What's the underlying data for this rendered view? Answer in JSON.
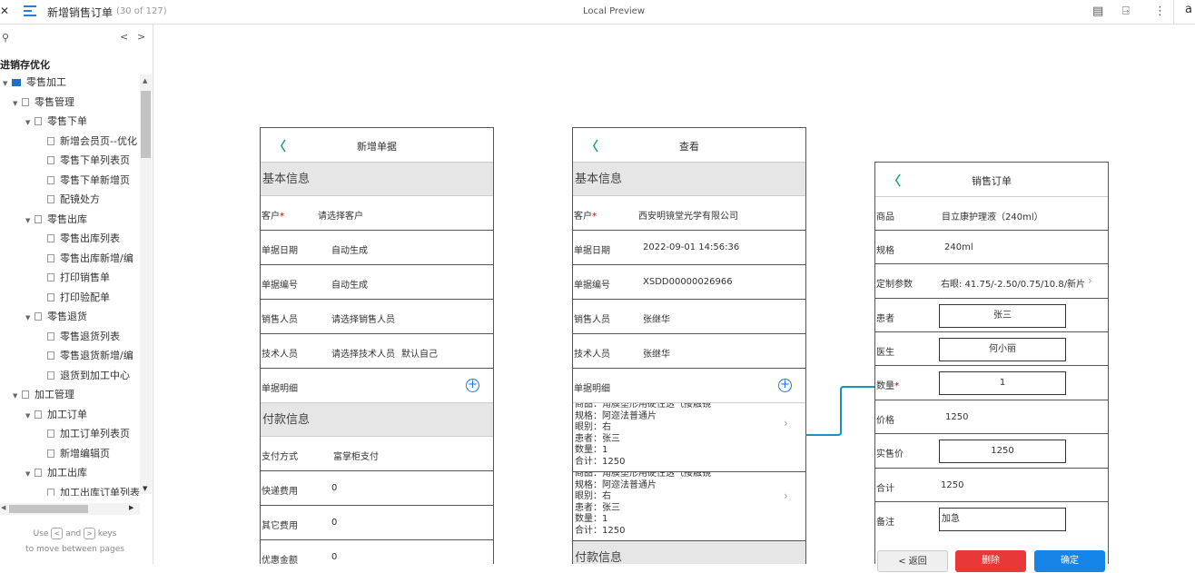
{
  "topbar": {
    "title": "新增销售订单",
    "count": "(30 of 127)",
    "preview": "Local Preview",
    "close_icon": "close-icon",
    "right_letter": "a"
  },
  "sidebar": {
    "heading": "进销存优化",
    "hint_line1_use": "Use",
    "hint_key_prev": "<",
    "hint_and": "and",
    "hint_key_next": ">",
    "hint_keys": "keys",
    "hint_line2": "to move between pages",
    "tree": [
      {
        "label": "零售加工",
        "level": 0,
        "kind": "folder"
      },
      {
        "label": "零售管理",
        "level": 1,
        "kind": "page"
      },
      {
        "label": "零售下单",
        "level": 2,
        "kind": "page"
      },
      {
        "label": "新增会员页--优化",
        "level": 3,
        "kind": "page"
      },
      {
        "label": "零售下单列表页",
        "level": 3,
        "kind": "page"
      },
      {
        "label": "零售下单新增页",
        "level": 3,
        "kind": "page"
      },
      {
        "label": "配镜处方",
        "level": 3,
        "kind": "page"
      },
      {
        "label": "零售出库",
        "level": 2,
        "kind": "page"
      },
      {
        "label": "零售出库列表",
        "level": 3,
        "kind": "page"
      },
      {
        "label": "零售出库新增/编",
        "level": 3,
        "kind": "page"
      },
      {
        "label": "打印销售单",
        "level": 3,
        "kind": "page"
      },
      {
        "label": "打印验配单",
        "level": 3,
        "kind": "page"
      },
      {
        "label": "零售退货",
        "level": 2,
        "kind": "page"
      },
      {
        "label": "零售退货列表",
        "level": 3,
        "kind": "page"
      },
      {
        "label": "零售退货新增/编",
        "level": 3,
        "kind": "page"
      },
      {
        "label": "退货到加工中心",
        "level": 3,
        "kind": "page"
      },
      {
        "label": "加工管理",
        "level": 1,
        "kind": "page"
      },
      {
        "label": "加工订单",
        "level": 2,
        "kind": "page"
      },
      {
        "label": "加工订单列表页",
        "level": 3,
        "kind": "page"
      },
      {
        "label": "新增编辑页",
        "level": 3,
        "kind": "page"
      },
      {
        "label": "加工出库",
        "level": 2,
        "kind": "page"
      },
      {
        "label": "加工出库订单列表",
        "level": 3,
        "kind": "page"
      }
    ]
  },
  "frame1": {
    "title": "新增单据",
    "basic_section": "基本信息",
    "customer_label": "客户",
    "customer_value": "请选择客户",
    "date_label": "单据日期",
    "date_value": "自动生成",
    "number_label": "单据编号",
    "number_value": "自动生成",
    "sales_label": "销售人员",
    "sales_value": "请选择销售人员",
    "tech_label": "技术人员",
    "tech_value": "请选择技术人员",
    "tech_default": "默认自己",
    "detail_label": "单据明细",
    "payment_section": "付款信息",
    "pay_method_label": "支付方式",
    "pay_method_value": "富掌柜支付",
    "express_label": "快递费用",
    "express_value": "0",
    "other_label": "其它费用",
    "other_value": "0",
    "discount_label": "优惠金额",
    "discount_value": "0"
  },
  "frame2": {
    "title": "查看",
    "basic_section": "基本信息",
    "customer_label": "客户",
    "customer_value": "西安明镜堂光学有限公司",
    "date_label": "单据日期",
    "date_value": "2022-09-01 14:56:36",
    "number_label": "单据编号",
    "number_value": "XSDD00000026966",
    "sales_label": "销售人员",
    "sales_value": "张继华",
    "tech_label": "技术人员",
    "tech_value": "张继华",
    "detail_label": "单据明细",
    "items": [
      {
        "product": "商品：角膜塑形用硬性透气接触镜",
        "spec": "规格：阿迩法普通片",
        "eye": "眼别：右",
        "patient": "患者：张三",
        "qty": "数量：1",
        "total": "合计：1250"
      },
      {
        "product": "商品：角膜塑形用硬性透气接触镜",
        "spec": "规格：阿迩法普通片",
        "eye": "眼别：右",
        "patient": "患者：张三",
        "qty": "数量：1",
        "total": "合计：1250"
      }
    ],
    "payment_section": "付款信息"
  },
  "frame3": {
    "title": "销售订单",
    "product_label": "商品",
    "product_value": "目立康护理液（240ml）",
    "spec_label": "规格",
    "spec_value": "240ml",
    "custom_label": "定制参数",
    "custom_value": "右眼: 41.75/-2.50/0.75/10.8/新片",
    "patient_label": "患者",
    "patient_value": "张三",
    "doctor_label": "医生",
    "doctor_value": "何小丽",
    "qty_label": "数量",
    "qty_value": "1",
    "price_label": "价格",
    "price_value": "1250",
    "actual_label": "实售价",
    "actual_value": "1250",
    "total_label": "合计",
    "total_value": "1250",
    "remark_label": "备注",
    "remark_value": "加急",
    "back_button": "< 返回",
    "delete_button": "删除",
    "confirm_button": "确定"
  },
  "colors": {
    "accent_blue": "#1b7ae6",
    "back_green": "#1aa56e",
    "required_red": "#d00000",
    "delete_red": "#e83838",
    "confirm_blue": "#1784e8",
    "connector": "#1a8fc0"
  }
}
